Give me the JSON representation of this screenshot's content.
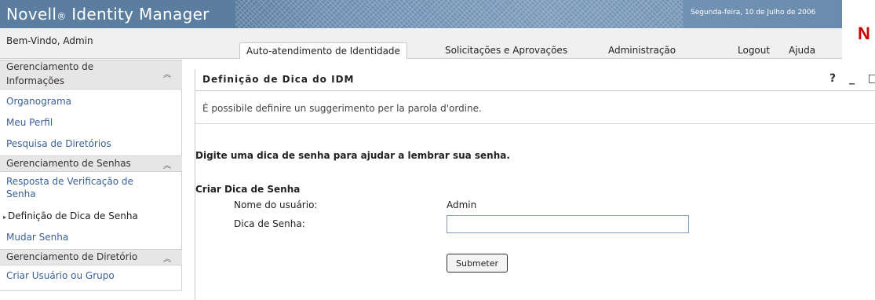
{
  "banner": {
    "title": "Novell",
    "reg": "®",
    "title_rest": " Identity Manager",
    "date": "Segunda-feira, 10 de Julho de 2006",
    "logo": "N"
  },
  "nav": {
    "welcome": "Bem-Vindo, Admin",
    "tabs": [
      {
        "label": "Auto-atendimento de Identidade",
        "active": true
      },
      {
        "label": "Solicitações e Aprovações",
        "active": false
      },
      {
        "label": "Administração",
        "active": false
      }
    ],
    "logout": "Logout",
    "help": "Ajuda"
  },
  "sidebar": {
    "sections": [
      {
        "title_line1": "Gerenciamento de",
        "title_line2": "Informações",
        "items": [
          "Organograma",
          "Meu Perfil",
          "Pesquisa de Diretórios"
        ]
      },
      {
        "title": "Gerenciamento de Senhas",
        "items": [
          "Resposta de Verificação de",
          "Senha",
          "Definição de Dica de Senha",
          "Mudar Senha"
        ]
      },
      {
        "title": "Gerenciamento de Diretório",
        "items": [
          "Criar Usuário ou Grupo"
        ]
      }
    ],
    "collapse_icon": "double-chevron-up-icon"
  },
  "panel": {
    "title": "Definição de Dica do IDM",
    "tools": [
      "?",
      "_",
      "□"
    ],
    "info": "È possibile definire un suggerimento per la parola d'ordine.",
    "instructions": "Digite uma dica de senha para ajudar a lembrar sua senha.",
    "form_title": "Criar Dica de Senha",
    "username_label": "Nome do usuário:",
    "username_value": "Admin",
    "hint_label": "Dica de Senha:",
    "hint_value": "",
    "submit": "Submeter"
  },
  "colors": {
    "banner": "#5b7ea0",
    "link": "#3a5f9a",
    "logo": "#cc0000"
  }
}
